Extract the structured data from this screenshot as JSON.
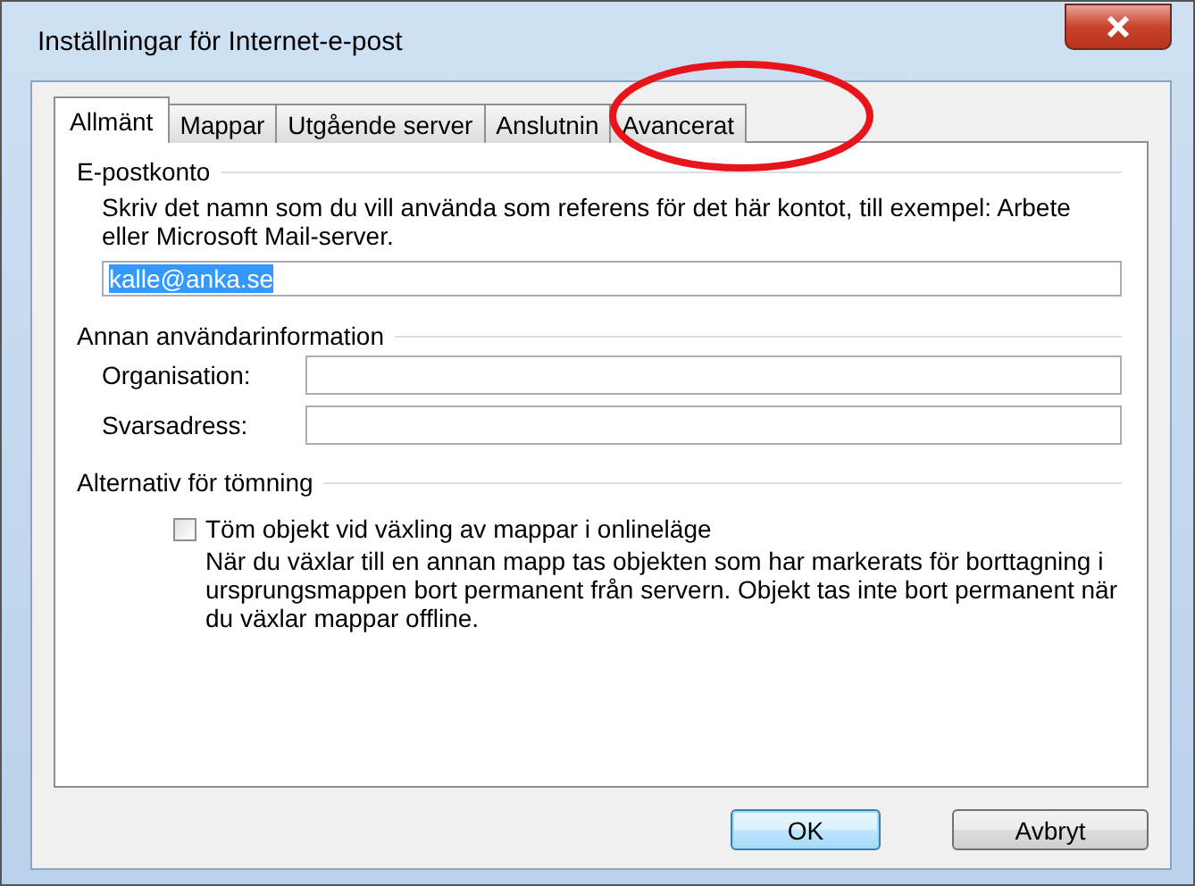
{
  "window": {
    "title": "Inställningar för Internet-e-post"
  },
  "tabs": [
    {
      "label": "Allmänt",
      "selected": true
    },
    {
      "label": "Mappar",
      "selected": false
    },
    {
      "label": "Utgående server",
      "selected": false
    },
    {
      "label": "Anslutnin",
      "selected": false
    },
    {
      "label": "Avancerat",
      "selected": false
    }
  ],
  "highlight": {
    "kind": "ellipse",
    "color": "#e8141c"
  },
  "email_account": {
    "heading": "E-postkonto",
    "description": "Skriv det namn som du vill använda som referens för det här kontot, till exempel: Arbete eller Microsoft Mail-server.",
    "value": "kalle@anka.se",
    "value_selected": true
  },
  "other_info": {
    "heading": "Annan användarinformation",
    "fields": [
      {
        "label": "Organisation:"
      },
      {
        "label": "Svarsadress:"
      }
    ]
  },
  "purge": {
    "heading": "Alternativ för tömning",
    "option": {
      "label": "Töm objekt vid växling av mappar i onlineläge",
      "checked": false
    },
    "description": "När du växlar till en annan mapp tas objekten som har markerats för borttagning i ursprungsmappen bort permanent från servern. Objekt tas inte bort permanent när du växlar mappar offline."
  },
  "buttons": [
    {
      "label": "OK",
      "default": true
    },
    {
      "label": "Avbryt",
      "default": false
    }
  ]
}
